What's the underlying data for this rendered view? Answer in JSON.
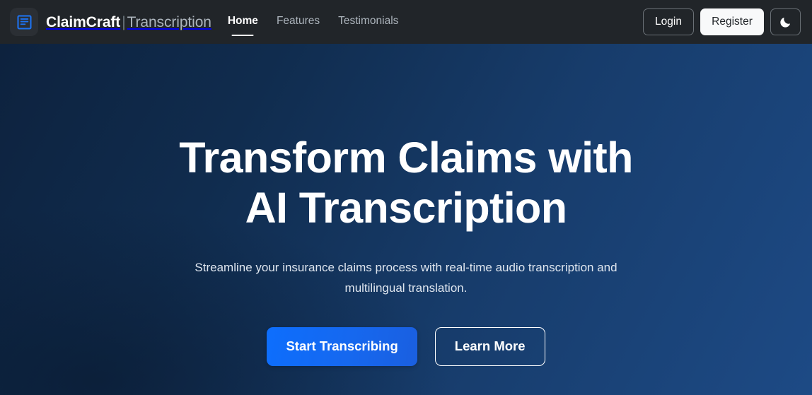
{
  "navbar": {
    "logo_icon": "article-document-icon",
    "brand_name": "ClaimCraft",
    "brand_separator": "|",
    "brand_subtitle": "Transcription",
    "links": [
      {
        "label": "Home",
        "active": true
      },
      {
        "label": "Features",
        "active": false
      },
      {
        "label": "Testimonials",
        "active": false
      }
    ],
    "login_label": "Login",
    "register_label": "Register",
    "theme_toggle_icon": "moon-icon",
    "background_color": "#212529",
    "logo_accent_color": "#1d74f5"
  },
  "hero": {
    "title_line_1": "Transform Claims with",
    "title_line_2": "AI Transcription",
    "subtitle": "Streamline your insurance claims process with real-time audio transcription and multilingual translation.",
    "primary_cta_label": "Start Transcribing",
    "secondary_cta_label": "Learn More",
    "gradient_start": "#0d223e",
    "gradient_end": "#1d4a85",
    "primary_cta_color": "#0d6efd"
  }
}
